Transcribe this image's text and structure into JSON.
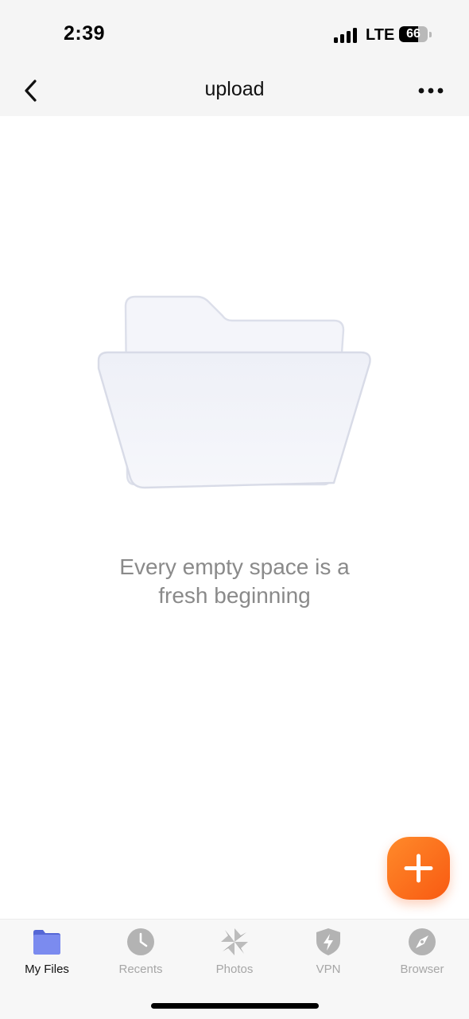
{
  "status_bar": {
    "time": "2:39",
    "network": "LTE",
    "battery_percent": "66",
    "signal_icon": "cellular-signal-icon",
    "battery_icon": "battery-icon"
  },
  "nav": {
    "title": "upload",
    "back_icon": "chevron-left-icon",
    "more_icon": "more-horizontal-icon"
  },
  "empty_state": {
    "illustration": "empty-folder-illustration",
    "message_line1": "Every empty space is a",
    "message_line2": "fresh beginning"
  },
  "fab": {
    "icon": "plus-icon",
    "color": "#f96b1c"
  },
  "tabs": [
    {
      "label": "My Files",
      "icon": "folder-icon",
      "active": true
    },
    {
      "label": "Recents",
      "icon": "clock-icon",
      "active": false
    },
    {
      "label": "Photos",
      "icon": "pinwheel-icon",
      "active": false
    },
    {
      "label": "VPN",
      "icon": "shield-bolt-icon",
      "active": false
    },
    {
      "label": "Browser",
      "icon": "compass-icon",
      "active": false
    }
  ],
  "colors": {
    "accent": "#f96b1c",
    "active_tab_icon": "#6c7ee8",
    "inactive_tab": "#a6a6a6",
    "message_text": "#8a8a8a"
  }
}
